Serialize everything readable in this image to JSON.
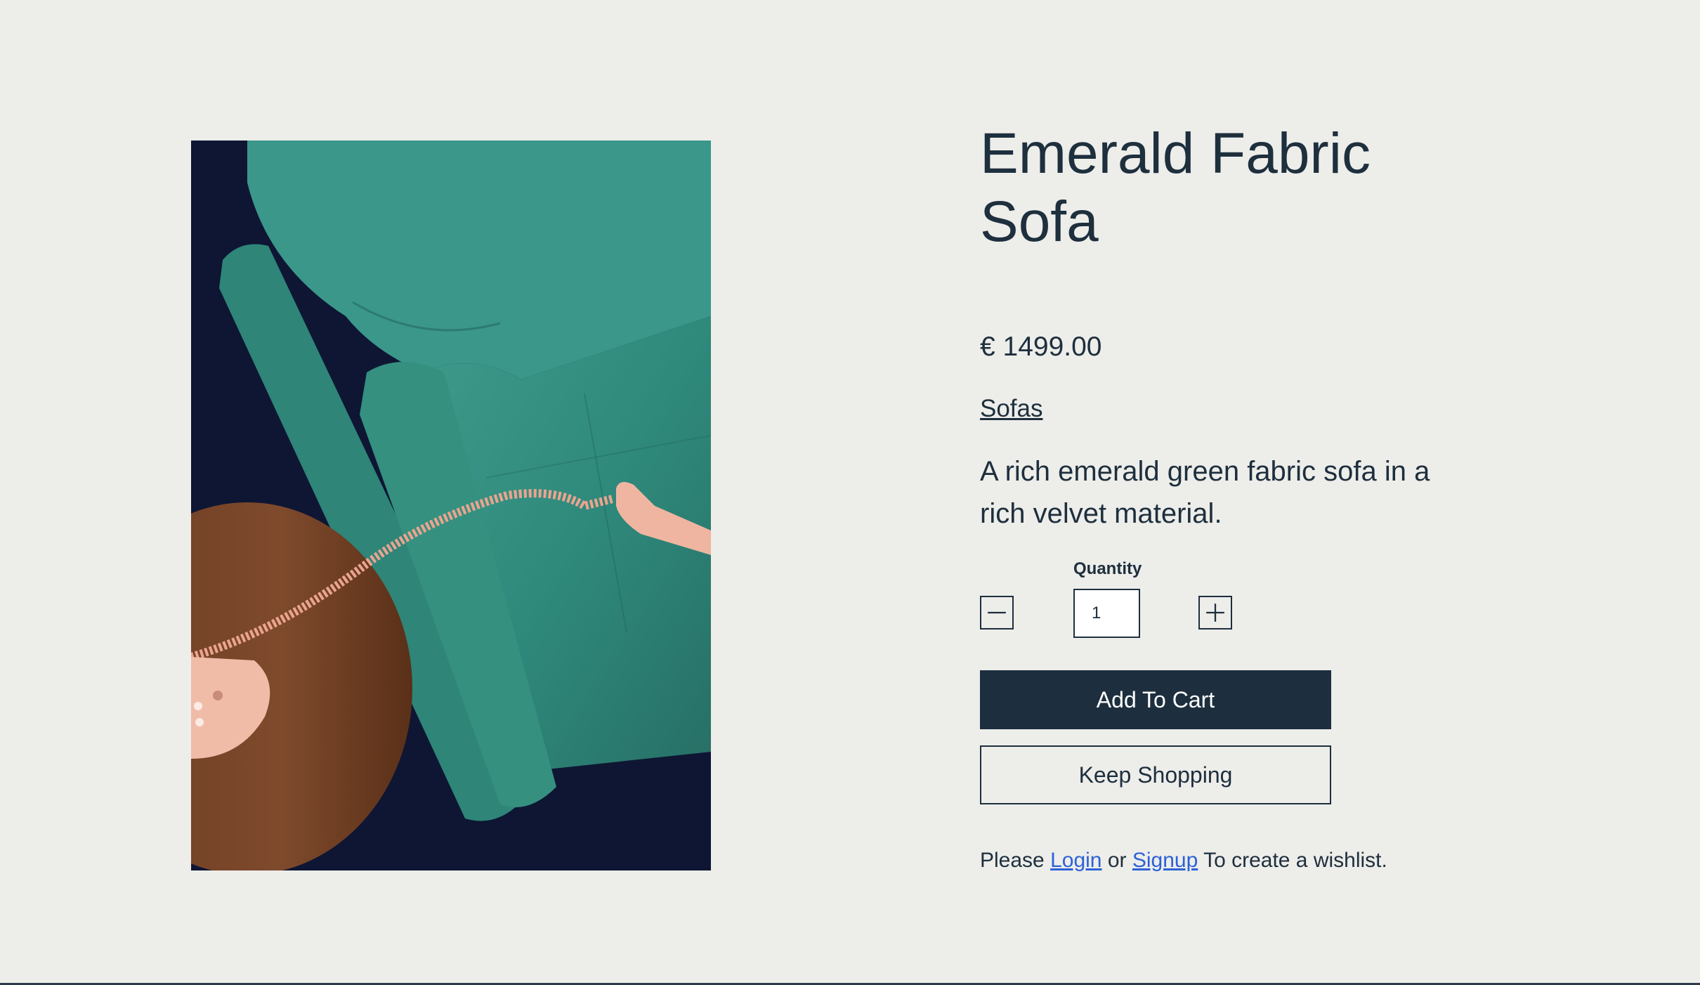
{
  "product": {
    "title": "Emerald Fabric Sofa",
    "price": "€ 1499.00",
    "category": "Sofas",
    "description": "A rich emerald green fabric sofa in a rich velvet material."
  },
  "quantity": {
    "label": "Quantity",
    "value": "1",
    "decrement_icon": "minus-icon",
    "increment_icon": "plus-icon"
  },
  "actions": {
    "add_to_cart": "Add To Cart",
    "keep_shopping": "Keep Shopping"
  },
  "wishlist": {
    "prefix": "Please",
    "login": "Login",
    "or": "or",
    "signup": "Signup",
    "suffix": "To create a wishlist."
  },
  "colors": {
    "background": "#ededea",
    "text": "#1e2f3d",
    "primary_button": "#1d2f3f",
    "link": "#2d62d6"
  }
}
